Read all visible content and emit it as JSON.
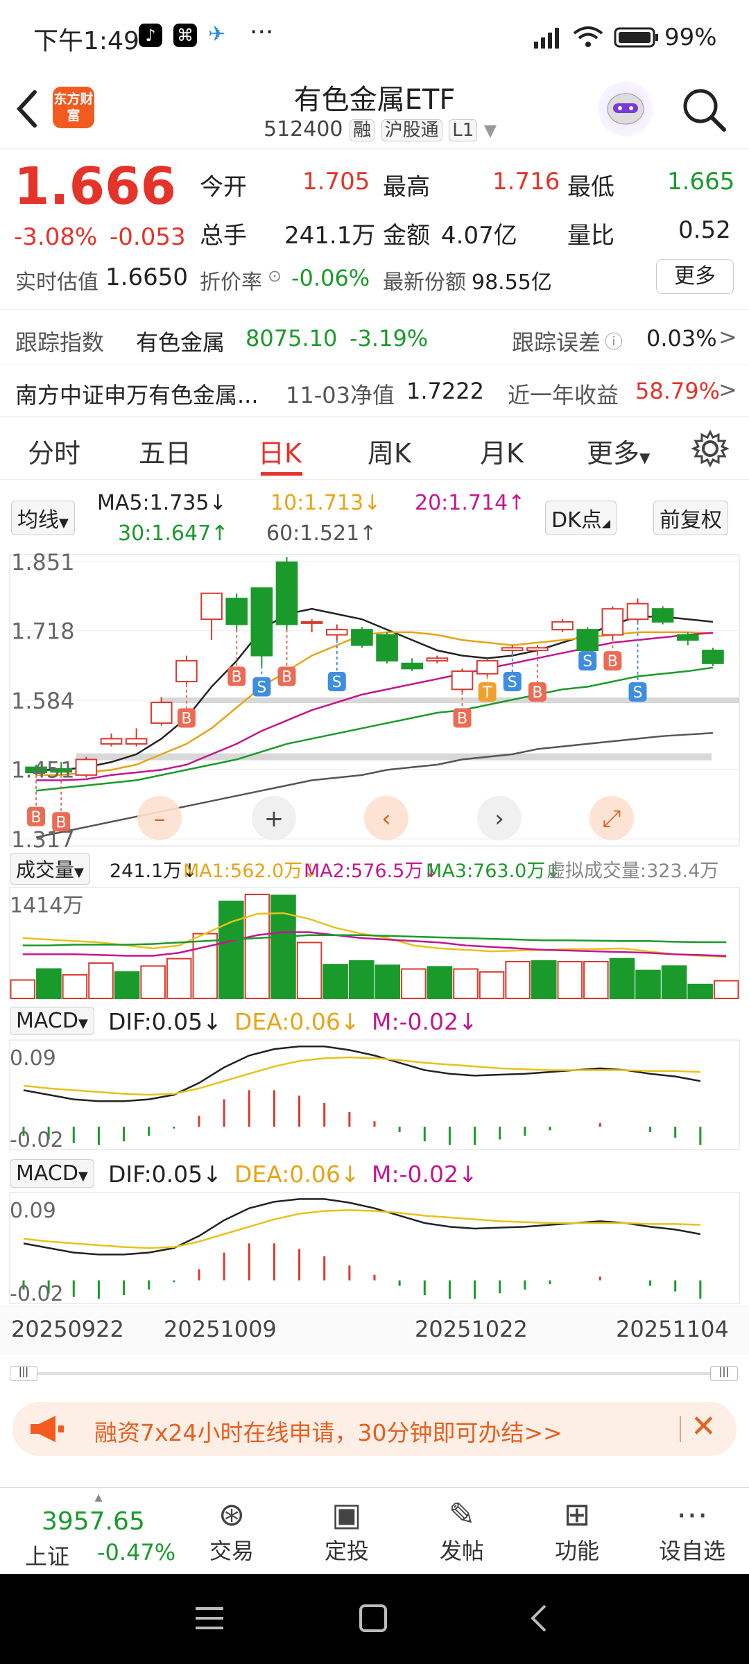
{
  "status_bar": {
    "time": "下午1:49",
    "dots": "···",
    "battery": "99%"
  },
  "header": {
    "back_icon": "chevron-left-icon",
    "logo_text": "东方财富",
    "title": "有色金属ETF",
    "code": "512400",
    "tag_margin": "融",
    "tag_connect": "沪股通",
    "tag_level": "L1",
    "search_icon": "search-icon"
  },
  "quote": {
    "price": "1.666",
    "change_pct": "-3.08%",
    "change": "-0.053",
    "open_label": "今开",
    "open": "1.705",
    "high_label": "最高",
    "high": "1.716",
    "low_label": "最低",
    "low": "1.665",
    "volume_label": "总手",
    "volume": "241.1万",
    "amount_label": "金额",
    "amount": "4.07亿",
    "ratio_label": "量比",
    "ratio": "0.52",
    "est_label": "实时估值",
    "est": "1.6650",
    "premium_label": "折价率",
    "premium": "-0.06%",
    "shares_label": "最新份额",
    "shares": "98.55亿",
    "more": "更多"
  },
  "tracking": {
    "label": "跟踪指数",
    "index_name": "有色金属",
    "index_value": "8075.10",
    "index_change": "-3.19%",
    "error_label": "跟踪误差",
    "error_value": "0.03%",
    "fund_name": "南方中证申万有色金属...",
    "nav_label": "11-03净值",
    "nav_value": "1.7222",
    "year_label": "近一年收益",
    "year_value": "58.79%"
  },
  "tabs": [
    "分时",
    "五日",
    "日K",
    "周K",
    "月K",
    "更多"
  ],
  "active_tab": "日K",
  "ma": {
    "selector": "均线",
    "ma5": "MA5:1.735↓",
    "ma10": "10:1.713↓",
    "ma20": "20:1.714↑",
    "ma30": "30:1.647↑",
    "ma60": "60:1.521↑",
    "dk": "DK点",
    "adjust": "前复权"
  },
  "volume_panel": {
    "selector": "成交量",
    "value": "241.1万↓",
    "ma1": "MA1:562.0万↓",
    "ma2": "MA2:576.5万↓",
    "ma3": "MA3:763.0万↓",
    "virtual": "虚拟成交量:323.4万",
    "axis_top": "1414万"
  },
  "macd_panel": {
    "selector": "MACD",
    "dif": "DIF:0.05↓",
    "dea": "DEA:0.06↓",
    "m": "M:-0.02↓",
    "axis_top": "0.09",
    "axis_bottom": "-0.02"
  },
  "dates": [
    "20250922",
    "20251009",
    "20251022",
    "20251104"
  ],
  "banner": {
    "text": "融资7x24小时在线申请，30分钟即可办结>>"
  },
  "bottom_nav": {
    "index_value": "3957.65",
    "index_name": "上证",
    "index_change": "-0.47%",
    "items": [
      {
        "label": "交易",
        "icon": "yen-icon"
      },
      {
        "label": "定投",
        "icon": "chart-icon"
      },
      {
        "label": "发帖",
        "icon": "pencil-icon"
      },
      {
        "label": "功能",
        "icon": "grid-icon"
      },
      {
        "label": "设自选",
        "icon": "more-icon"
      }
    ]
  },
  "chart_data": [
    {
      "type": "candlestick",
      "y_axis_labels": [
        "1.851",
        "1.718",
        "1.584",
        "1.451",
        "1.317"
      ],
      "ylim": [
        1.317,
        1.851
      ],
      "x_labels": [
        "20250922",
        "20251009",
        "20251022",
        "20251104"
      ],
      "candles": [
        {
          "o": 1.455,
          "c": 1.445,
          "h": 1.46,
          "l": 1.44
        },
        {
          "o": 1.452,
          "c": 1.446,
          "h": 1.465,
          "l": 1.44
        },
        {
          "o": 1.44,
          "c": 1.47,
          "h": 1.475,
          "l": 1.435
        },
        {
          "o": 1.5,
          "c": 1.51,
          "h": 1.52,
          "l": 1.495
        },
        {
          "o": 1.5,
          "c": 1.51,
          "h": 1.53,
          "l": 1.495
        },
        {
          "o": 1.54,
          "c": 1.58,
          "h": 1.59,
          "l": 1.535
        },
        {
          "o": 1.62,
          "c": 1.66,
          "h": 1.67,
          "l": 1.615
        },
        {
          "o": 1.74,
          "c": 1.79,
          "h": 1.79,
          "l": 1.7
        },
        {
          "o": 1.78,
          "c": 1.73,
          "h": 1.79,
          "l": 1.72
        },
        {
          "o": 1.8,
          "c": 1.67,
          "h": 1.8,
          "l": 1.65
        },
        {
          "o": 1.85,
          "c": 1.73,
          "h": 1.86,
          "l": 1.72
        },
        {
          "o": 1.735,
          "c": 1.735,
          "h": 1.74,
          "l": 1.715
        },
        {
          "o": 1.71,
          "c": 1.72,
          "h": 1.73,
          "l": 1.7
        },
        {
          "o": 1.72,
          "c": 1.69,
          "h": 1.725,
          "l": 1.685
        },
        {
          "o": 1.71,
          "c": 1.66,
          "h": 1.715,
          "l": 1.655
        },
        {
          "o": 1.655,
          "c": 1.645,
          "h": 1.665,
          "l": 1.64
        },
        {
          "o": 1.66,
          "c": 1.665,
          "h": 1.67,
          "l": 1.655
        },
        {
          "o": 1.605,
          "c": 1.64,
          "h": 1.645,
          "l": 1.6
        },
        {
          "o": 1.635,
          "c": 1.66,
          "h": 1.665,
          "l": 1.63
        },
        {
          "o": 1.68,
          "c": 1.685,
          "h": 1.69,
          "l": 1.675
        },
        {
          "o": 1.68,
          "c": 1.685,
          "h": 1.69,
          "l": 1.675
        },
        {
          "o": 1.72,
          "c": 1.735,
          "h": 1.74,
          "l": 1.715
        },
        {
          "o": 1.72,
          "c": 1.68,
          "h": 1.725,
          "l": 1.675
        },
        {
          "o": 1.71,
          "c": 1.76,
          "h": 1.765,
          "l": 1.7
        },
        {
          "o": 1.74,
          "c": 1.77,
          "h": 1.78,
          "l": 1.735
        },
        {
          "o": 1.76,
          "c": 1.735,
          "h": 1.765,
          "l": 1.73
        },
        {
          "o": 1.71,
          "c": 1.7,
          "h": 1.715,
          "l": 1.69
        },
        {
          "o": 1.68,
          "c": 1.655,
          "h": 1.685,
          "l": 1.65
        }
      ],
      "ma_lines": {
        "ma5": [
          1.45,
          1.45,
          1.455,
          1.465,
          1.48,
          1.51,
          1.55,
          1.61,
          1.66,
          1.72,
          1.75,
          1.76,
          1.75,
          1.74,
          1.72,
          1.7,
          1.68,
          1.67,
          1.665,
          1.67,
          1.68,
          1.695,
          1.71,
          1.73,
          1.745,
          1.745,
          1.74,
          1.735
        ],
        "ma10": [
          1.44,
          1.44,
          1.445,
          1.45,
          1.46,
          1.48,
          1.5,
          1.53,
          1.57,
          1.61,
          1.64,
          1.67,
          1.69,
          1.71,
          1.715,
          1.715,
          1.71,
          1.7,
          1.695,
          1.69,
          1.695,
          1.7,
          1.705,
          1.71,
          1.715,
          1.715,
          1.715,
          1.713
        ],
        "ma20": [
          1.43,
          1.43,
          1.432,
          1.44,
          1.445,
          1.45,
          1.46,
          1.48,
          1.5,
          1.525,
          1.545,
          1.565,
          1.58,
          1.595,
          1.605,
          1.615,
          1.625,
          1.635,
          1.645,
          1.655,
          1.665,
          1.675,
          1.685,
          1.695,
          1.7,
          1.705,
          1.71,
          1.714
        ],
        "ma30": [
          1.41,
          1.415,
          1.42,
          1.425,
          1.43,
          1.44,
          1.45,
          1.46,
          1.47,
          1.485,
          1.5,
          1.51,
          1.52,
          1.53,
          1.54,
          1.55,
          1.56,
          1.565,
          1.575,
          1.585,
          1.595,
          1.605,
          1.61,
          1.62,
          1.63,
          1.635,
          1.64,
          1.647
        ],
        "ma60": [
          1.32,
          1.33,
          1.34,
          1.35,
          1.36,
          1.37,
          1.38,
          1.39,
          1.4,
          1.41,
          1.42,
          1.43,
          1.435,
          1.44,
          1.45,
          1.455,
          1.46,
          1.47,
          1.475,
          1.48,
          1.49,
          1.495,
          1.5,
          1.505,
          1.51,
          1.515,
          1.518,
          1.521
        ]
      },
      "markers": [
        {
          "i": 0,
          "type": "B",
          "y": 1.36
        },
        {
          "i": 1,
          "type": "B",
          "y": 1.35
        },
        {
          "i": 6,
          "type": "B",
          "y": 1.55
        },
        {
          "i": 8,
          "type": "B",
          "y": 1.63
        },
        {
          "i": 9,
          "type": "S",
          "y": 1.61
        },
        {
          "i": 10,
          "type": "B",
          "y": 1.63
        },
        {
          "i": 12,
          "type": "S",
          "y": 1.62
        },
        {
          "i": 17,
          "type": "B",
          "y": 1.55
        },
        {
          "i": 18,
          "type": "T",
          "y": 1.6
        },
        {
          "i": 19,
          "type": "S",
          "y": 1.62
        },
        {
          "i": 20,
          "type": "B",
          "y": 1.6
        },
        {
          "i": 22,
          "type": "S",
          "y": 1.66
        },
        {
          "i": 23,
          "type": "B",
          "y": 1.66
        },
        {
          "i": 24,
          "type": "S",
          "y": 1.6
        }
      ]
    },
    {
      "type": "bar",
      "ylabel": "成交量",
      "ylim": [
        0,
        1414
      ],
      "values": [
        250,
        400,
        320,
        480,
        360,
        440,
        540,
        880,
        1320,
        1414,
        1400,
        760,
        460,
        510,
        450,
        400,
        430,
        400,
        360,
        500,
        510,
        500,
        500,
        540,
        380,
        440,
        190,
        240
      ],
      "colors": [
        "up",
        "down",
        "up",
        "up",
        "down",
        "up",
        "up",
        "up",
        "down",
        "up",
        "down",
        "up",
        "down",
        "down",
        "down",
        "up",
        "down",
        "up",
        "up",
        "up",
        "down",
        "up",
        "up",
        "down",
        "down",
        "down",
        "down",
        "up"
      ],
      "ma_lines": {
        "ma1": [
          820,
          800,
          780,
          760,
          720,
          680,
          720,
          880,
          1040,
          1150,
          1160,
          1080,
          960,
          880,
          820,
          720,
          680,
          660,
          640,
          650,
          660,
          670,
          670,
          680,
          640,
          600,
          580,
          562
        ],
        "ma2": [
          600,
          600,
          600,
          590,
          580,
          580,
          620,
          700,
          780,
          860,
          900,
          900,
          860,
          820,
          800,
          780,
          760,
          720,
          700,
          680,
          660,
          650,
          640,
          630,
          620,
          600,
          590,
          576.5
        ],
        "ma3": [
          720,
          720,
          730,
          730,
          730,
          740,
          760,
          780,
          800,
          820,
          840,
          860,
          860,
          860,
          850,
          840,
          830,
          820,
          810,
          800,
          790,
          790,
          785,
          780,
          780,
          770,
          765,
          763
        ]
      }
    },
    {
      "type": "line",
      "ylabel": "MACD",
      "ylim": [
        -0.025,
        0.095
      ],
      "series": [
        {
          "name": "DIF",
          "values": [
            0.04,
            0.035,
            0.03,
            0.028,
            0.028,
            0.03,
            0.035,
            0.048,
            0.065,
            0.078,
            0.085,
            0.088,
            0.088,
            0.084,
            0.078,
            0.07,
            0.062,
            0.058,
            0.056,
            0.057,
            0.058,
            0.06,
            0.062,
            0.064,
            0.062,
            0.058,
            0.055,
            0.05
          ]
        },
        {
          "name": "DEA",
          "values": [
            0.045,
            0.042,
            0.04,
            0.038,
            0.036,
            0.035,
            0.036,
            0.042,
            0.05,
            0.058,
            0.066,
            0.072,
            0.075,
            0.076,
            0.075,
            0.073,
            0.07,
            0.068,
            0.066,
            0.064,
            0.063,
            0.062,
            0.062,
            0.062,
            0.062,
            0.061,
            0.061,
            0.06
          ]
        }
      ],
      "m_values": [
        -0.01,
        -0.014,
        -0.018,
        -0.02,
        -0.016,
        -0.01,
        -0.002,
        0.012,
        0.03,
        0.04,
        0.04,
        0.034,
        0.026,
        0.016,
        0.006,
        -0.006,
        -0.016,
        -0.02,
        -0.02,
        -0.014,
        -0.01,
        -0.004,
        0.0,
        0.004,
        0.0,
        -0.006,
        -0.012,
        -0.02
      ]
    }
  ]
}
